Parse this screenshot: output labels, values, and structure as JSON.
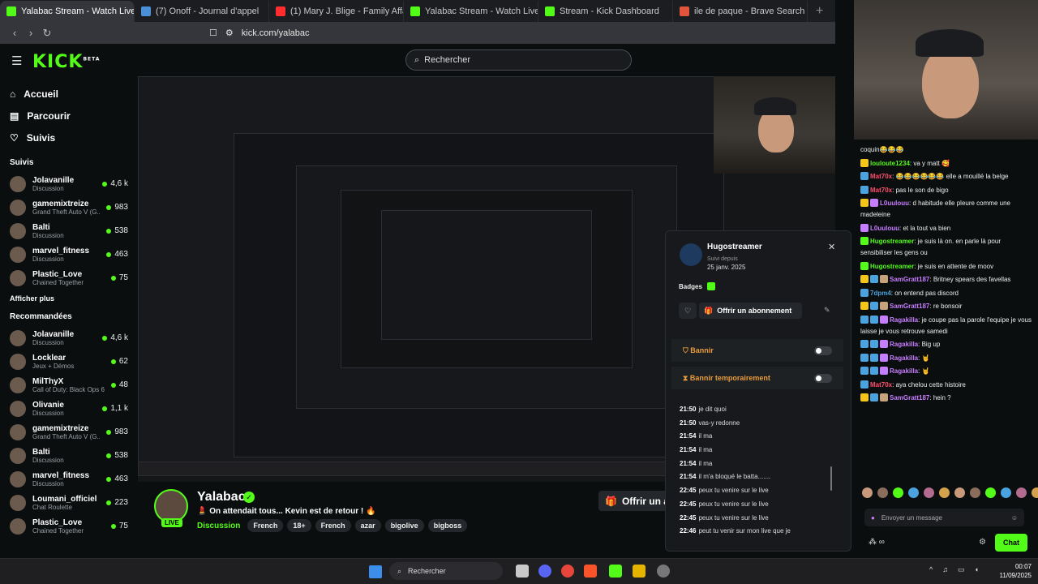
{
  "browser": {
    "tabs": [
      {
        "label": "Yalabac Stream - Watch Live on Kick",
        "active": true,
        "color": "#53fc18"
      },
      {
        "label": "(7) Onoff - Journal d'appel",
        "active": false,
        "color": "#4a90d9"
      },
      {
        "label": "(1) Mary J. Blige - Family Affair (Offic",
        "active": false,
        "color": "#ff2d2d"
      },
      {
        "label": "Yalabac Stream - Watch Live on Kick",
        "active": false,
        "color": "#53fc18"
      },
      {
        "label": "Stream - Kick Dashboard",
        "active": false,
        "color": "#53fc18"
      },
      {
        "label": "ile de paque - Brave Search",
        "active": false,
        "color": "#e0553b"
      }
    ],
    "url": "kick.com/yalabac"
  },
  "header": {
    "logo": "KICK",
    "logo_sup": "BETA",
    "search_placeholder": "Rechercher"
  },
  "sidebar": {
    "nav": [
      {
        "label": "Accueil",
        "icon": "home-icon"
      },
      {
        "label": "Parcourir",
        "icon": "browse-icon"
      },
      {
        "label": "Suivis",
        "icon": "heart-icon"
      }
    ],
    "followed_title": "Suivis",
    "followed": [
      {
        "name": "Jolavanille",
        "category": "Discussion",
        "viewers": "4,6 k"
      },
      {
        "name": "gamemixtreize",
        "category": "Grand Theft Auto V (G...",
        "viewers": "983"
      },
      {
        "name": "Balti",
        "category": "Discussion",
        "viewers": "538"
      },
      {
        "name": "marvel_fitness",
        "category": "Discussion",
        "viewers": "463"
      },
      {
        "name": "Plastic_Love",
        "category": "Chained Together",
        "viewers": "75"
      }
    ],
    "show_more": "Afficher plus",
    "recommended_title": "Recommandées",
    "recommended": [
      {
        "name": "Jolavanille",
        "category": "Discussion",
        "viewers": "4,6 k"
      },
      {
        "name": "Locklear",
        "category": "Jeux + Démos",
        "viewers": "62"
      },
      {
        "name": "MilThyX",
        "category": "Call of Duty: Black Ops 6",
        "viewers": "48"
      },
      {
        "name": "Olivanie",
        "category": "Discussion",
        "viewers": "1,1 k"
      },
      {
        "name": "gamemixtreize",
        "category": "Grand Theft Auto V (G...",
        "viewers": "983"
      },
      {
        "name": "Balti",
        "category": "Discussion",
        "viewers": "538"
      },
      {
        "name": "marvel_fitness",
        "category": "Discussion",
        "viewers": "463"
      },
      {
        "name": "Loumani_officiel",
        "category": "Chat Roulette",
        "viewers": "223"
      },
      {
        "name": "Plastic_Love",
        "category": "Chained Together",
        "viewers": "75"
      }
    ]
  },
  "stream": {
    "streamer": "Yalabac",
    "live": "LIVE",
    "title": "💄 On attendait tous... Kevin est de retour ! 🔥",
    "category": "Discussion",
    "tags": [
      "French",
      "18+",
      "French",
      "azar",
      "bigolive",
      "bigboss"
    ],
    "subscribe_label": "Offrir un ab"
  },
  "mod_panel": {
    "username": "Hugostreamer",
    "since_label": "Suivi depuis",
    "since_date": "25 janv. 2025",
    "badges_label": "Badges",
    "gift_sub": "Offrir un abonnement",
    "ban": "Bannir",
    "timeout": "Bannir temporairement",
    "log": [
      {
        "time": "21:50",
        "text": "je dit quoi"
      },
      {
        "time": "21:50",
        "text": "vas-y redonne"
      },
      {
        "time": "21:54",
        "text": "il ma"
      },
      {
        "time": "21:54",
        "text": "il ma"
      },
      {
        "time": "21:54",
        "text": "il ma"
      },
      {
        "time": "21:54",
        "text": "il m'a bloqué le batta......."
      },
      {
        "time": "22:45",
        "text": "peux tu venire sur le live"
      },
      {
        "time": "22:45",
        "text": "peux tu venire sur le live"
      },
      {
        "time": "22:45",
        "text": "peux tu venire sur le live"
      },
      {
        "time": "22:46",
        "text": "peut tu venir sur mon live que je"
      }
    ]
  },
  "chat": {
    "messages": [
      {
        "user": "",
        "text": "coquin😂😂😂",
        "color": "#ffffff",
        "badges": []
      },
      {
        "user": "louloute1234",
        "text": "va y matt 🥰",
        "color": "#53fc18",
        "badges": [
          "#f5c518"
        ]
      },
      {
        "user": "Mat70x",
        "text": "😂😂😂😂😂😂 elle a mouillé la belge",
        "color": "#ff4d6d",
        "badges": [
          "#4aa3df"
        ]
      },
      {
        "user": "Mat70x",
        "text": "pas le son de bigo",
        "color": "#ff4d6d",
        "badges": [
          "#4aa3df"
        ]
      },
      {
        "user": "L0uulouu",
        "text": "d habitude elle pleure comme une madeleine",
        "color": "#c77dff",
        "badges": [
          "#f5c518",
          "#c77dff"
        ]
      },
      {
        "user": "L0uulouu",
        "text": "et la tout va bien",
        "color": "#c77dff",
        "badges": [
          "#c77dff"
        ]
      },
      {
        "user": "Hugostreamer",
        "text": "je suis là on. en parle là pour sensibiliser les gens ou",
        "color": "#53fc18",
        "badges": [
          "#53fc18"
        ]
      },
      {
        "user": "Hugostreamer",
        "text": "je suis en attente de moov",
        "color": "#53fc18",
        "badges": [
          "#53fc18"
        ]
      },
      {
        "user": "SamGratt187",
        "text": "Britney spears des favellas",
        "color": "#c77dff",
        "badges": [
          "#f5c518",
          "#4aa3df",
          "#c8a27a"
        ]
      },
      {
        "user": "7dpm4",
        "text": "on entend pas discord",
        "color": "#4aa3df",
        "badges": [
          "#4aa3df"
        ]
      },
      {
        "user": "SamGratt187",
        "text": "re bonsoir",
        "color": "#c77dff",
        "badges": [
          "#f5c518",
          "#4aa3df",
          "#c8a27a"
        ]
      },
      {
        "user": "Ragakilla",
        "text": "je coupe pas la parole l'equipe je vous laisse je vous retrouve samedi",
        "color": "#c77dff",
        "badges": [
          "#4aa3df",
          "#4aa3df",
          "#c77dff"
        ]
      },
      {
        "user": "Ragakilla",
        "text": "Big up",
        "color": "#c77dff",
        "badges": [
          "#4aa3df",
          "#4aa3df",
          "#c77dff"
        ]
      },
      {
        "user": "Ragakilla",
        "text": "🤘",
        "color": "#c77dff",
        "badges": [
          "#4aa3df",
          "#4aa3df",
          "#c77dff"
        ]
      },
      {
        "user": "Ragakilla",
        "text": "🤘",
        "color": "#c77dff",
        "badges": [
          "#4aa3df",
          "#4aa3df",
          "#c77dff"
        ]
      },
      {
        "user": "Mat70x",
        "text": "aya chelou cette histoire",
        "color": "#ff4d6d",
        "badges": [
          "#4aa3df"
        ]
      },
      {
        "user": "SamGratt187",
        "text": "hein ?",
        "color": "#c77dff",
        "badges": [
          "#f5c518",
          "#4aa3df",
          "#c8a27a"
        ]
      }
    ],
    "input_placeholder": "Envoyer un message",
    "send_label": "Chat"
  },
  "taskbar": {
    "search": "Rechercher",
    "time": "00:07",
    "date": "11/09/2025"
  },
  "colors": {
    "accent": "#53fc18",
    "background": "#0b0e0f"
  }
}
